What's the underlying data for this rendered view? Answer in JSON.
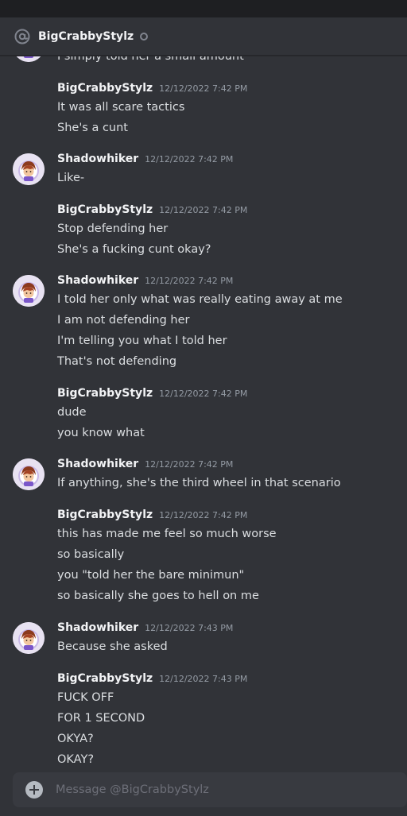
{
  "header": {
    "name": "BigCrabbyStylz"
  },
  "colors": {
    "bg": "#313338",
    "header_bg": "#1e1f22",
    "author": "#f2f3f5",
    "text": "#dbdee1",
    "timestamp": "#949ba4"
  },
  "messages": [
    {
      "author": "",
      "timestamp": "",
      "avatar": true,
      "lines": [
        "I simply told her a small amount"
      ]
    },
    {
      "author": "BigCrabbyStylz",
      "timestamp": "12/12/2022 7:42 PM",
      "avatar": false,
      "lines": [
        "It was all scare tactics",
        "She's a cunt"
      ]
    },
    {
      "author": "Shadowhiker",
      "timestamp": "12/12/2022 7:42 PM",
      "avatar": true,
      "lines": [
        "Like-"
      ]
    },
    {
      "author": "BigCrabbyStylz",
      "timestamp": "12/12/2022 7:42 PM",
      "avatar": false,
      "lines": [
        "Stop defending her",
        "She's a fucking cunt okay?"
      ]
    },
    {
      "author": "Shadowhiker",
      "timestamp": "12/12/2022 7:42 PM",
      "avatar": true,
      "lines": [
        "I told her only what was really eating away at me",
        "I am not defending her",
        "I'm telling you what I told her",
        "That's not defending"
      ]
    },
    {
      "author": "BigCrabbyStylz",
      "timestamp": "12/12/2022 7:42 PM",
      "avatar": false,
      "lines": [
        "dude",
        "you know what"
      ]
    },
    {
      "author": "Shadowhiker",
      "timestamp": "12/12/2022 7:42 PM",
      "avatar": true,
      "lines": [
        "If anything, she's the third wheel in that scenario"
      ]
    },
    {
      "author": "BigCrabbyStylz",
      "timestamp": "12/12/2022 7:42 PM",
      "avatar": false,
      "lines": [
        "this has made me feel so much worse",
        "so basically",
        "you \"told her the bare minimun\"",
        "so basically she goes to hell on me"
      ]
    },
    {
      "author": "Shadowhiker",
      "timestamp": "12/12/2022 7:43 PM",
      "avatar": true,
      "lines": [
        "Because she asked"
      ]
    },
    {
      "author": "BigCrabbyStylz",
      "timestamp": "12/12/2022 7:43 PM",
      "avatar": false,
      "lines": [
        "FUCK OFF",
        "FOR 1 SECOND",
        "OKYA?",
        "OKAY?"
      ]
    }
  ],
  "composer": {
    "placeholder": "Message @BigCrabbyStylz",
    "value": ""
  }
}
